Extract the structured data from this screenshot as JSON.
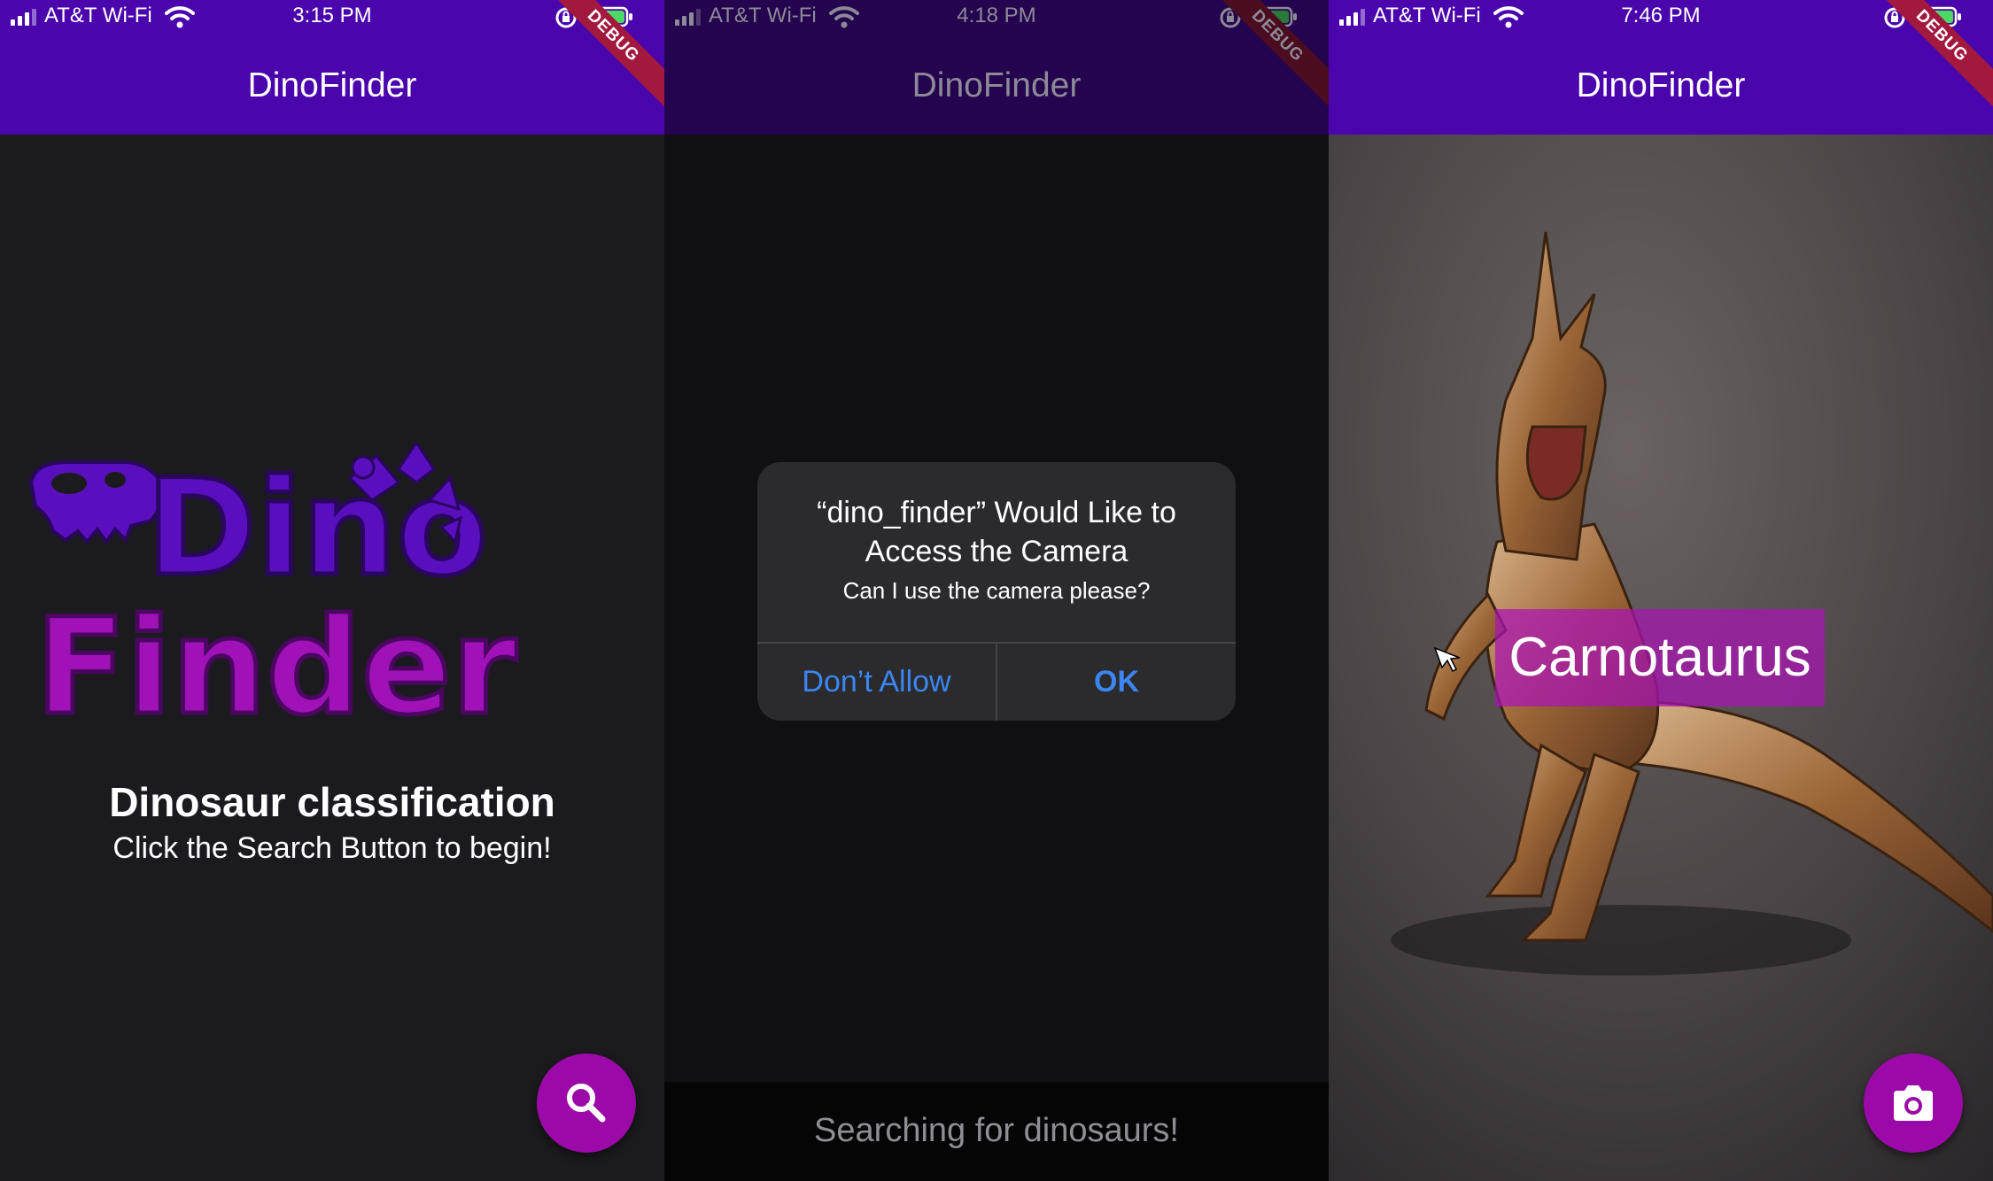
{
  "screens": [
    {
      "status": {
        "carrier": "AT&T Wi-Fi",
        "time": "3:15 PM"
      },
      "app_title": "DinoFinder",
      "debug_banner": "DEBUG",
      "logo": {
        "line1": "Dino",
        "line2": "Finder"
      },
      "headline": "Dinosaur classification",
      "subline": "Click the Search Button to begin!",
      "fab_icon": "search-icon"
    },
    {
      "status": {
        "carrier": "AT&T Wi-Fi",
        "time": "4:18 PM"
      },
      "app_title": "DinoFinder",
      "debug_banner": "DEBUG",
      "dialog": {
        "title": "“dino_finder” Would Like to Access the Camera",
        "message": "Can I use the camera please?",
        "deny_label": "Don’t Allow",
        "ok_label": "OK"
      },
      "bottom_text": "Searching for dinosaurs!"
    },
    {
      "status": {
        "carrier": "AT&T Wi-Fi",
        "time": "7:46 PM"
      },
      "app_title": "DinoFinder",
      "debug_banner": "DEBUG",
      "prediction": "Carnotaurus",
      "fab_icon": "camera-icon"
    }
  ],
  "colors": {
    "app_bar": "#4a06ac",
    "fab": "#9b0aa8",
    "logo_dino": "#5a0fbf",
    "logo_finder": "#a012b8",
    "ios_blue": "#3b86f2",
    "debug_ribbon": "#a3183d"
  }
}
